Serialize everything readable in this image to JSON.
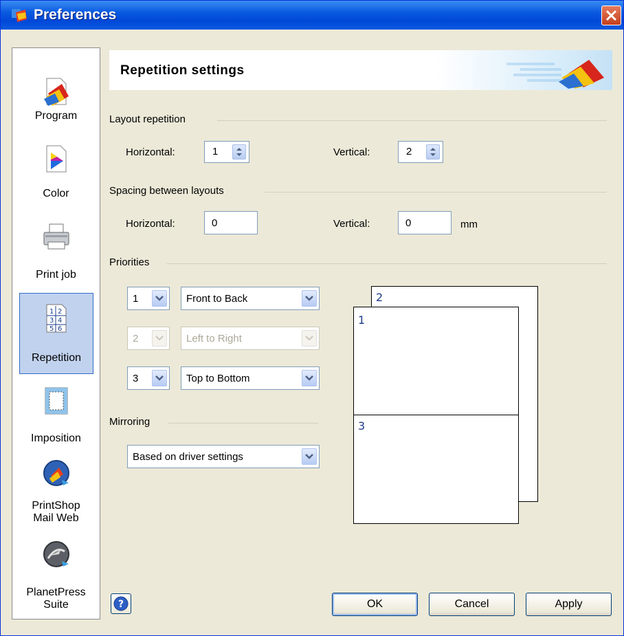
{
  "window": {
    "title": "Preferences"
  },
  "sidebar": {
    "items": [
      {
        "label": "Program",
        "icon": "program-icon"
      },
      {
        "label": "Color",
        "icon": "color-icon"
      },
      {
        "label": "Print job",
        "icon": "printer-icon"
      },
      {
        "label": "Repetition",
        "icon": "repetition-icon",
        "selected": true
      },
      {
        "label": "Imposition",
        "icon": "imposition-icon"
      },
      {
        "label": "PrintShop\nMail Web",
        "line1": "PrintShop",
        "line2": "Mail Web",
        "icon": "printshop-mail-web-icon"
      },
      {
        "label": "PlanetPress\nSuite",
        "line1": "PlanetPress",
        "line2": "Suite",
        "icon": "planetpress-suite-icon"
      }
    ]
  },
  "header": {
    "title": "Repetition settings"
  },
  "layout_repetition": {
    "title": "Layout repetition",
    "horizontal_label": "Horizontal:",
    "horizontal_value": "1",
    "vertical_label": "Vertical:",
    "vertical_value": "2"
  },
  "spacing": {
    "title": "Spacing between layouts",
    "horizontal_label": "Horizontal:",
    "horizontal_value": "0",
    "vertical_label": "Vertical:",
    "vertical_value": "0",
    "unit": "mm"
  },
  "priorities": {
    "title": "Priorities",
    "rows": [
      {
        "number": "1",
        "value": "Front to Back",
        "enabled": true
      },
      {
        "number": "2",
        "value": "Left to Right",
        "enabled": false
      },
      {
        "number": "3",
        "value": "Top to Bottom",
        "enabled": true
      }
    ]
  },
  "mirroring": {
    "title": "Mirroring",
    "value": "Based on driver settings"
  },
  "preview": {
    "labels": [
      "2",
      "1",
      "3"
    ]
  },
  "buttons": {
    "ok": "OK",
    "cancel": "Cancel",
    "apply": "Apply"
  },
  "colors": {
    "titlebar": "#0a5ae0",
    "selection": "#c1d2ee",
    "dialog_bg": "#ece9d8"
  }
}
